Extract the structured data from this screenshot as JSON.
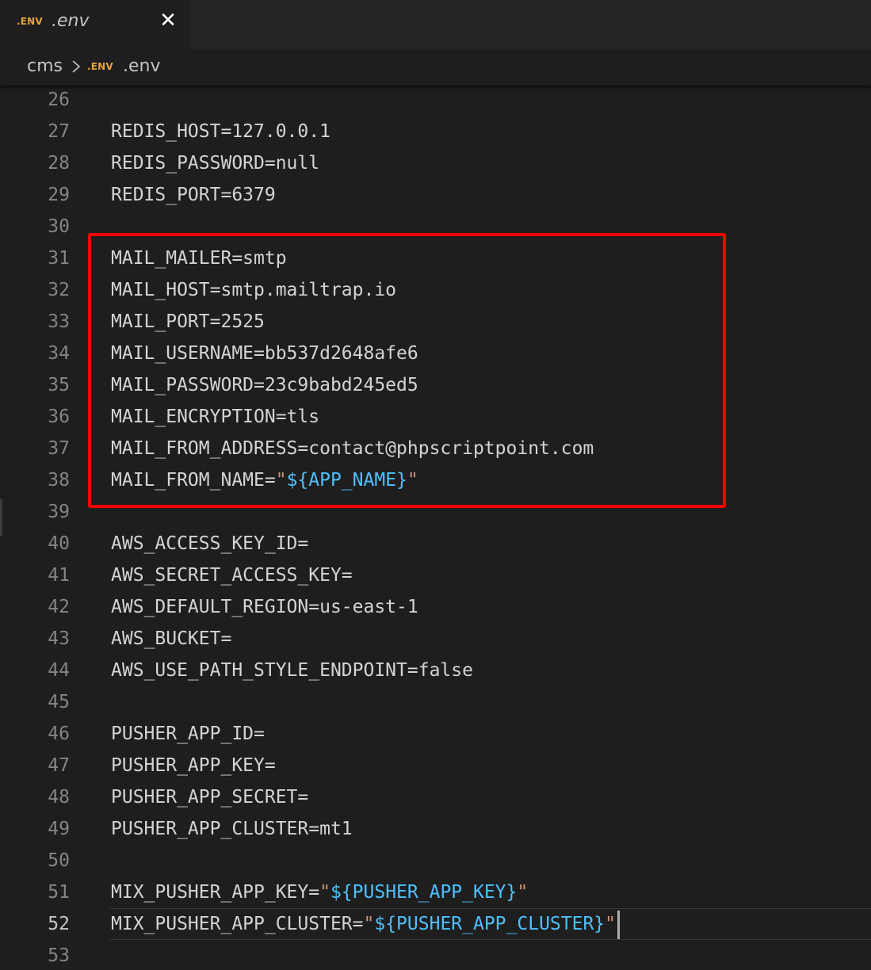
{
  "tab": {
    "badge": ".ENV",
    "label": ".env",
    "close_glyph": "✕"
  },
  "breadcrumb": {
    "folder": "cms",
    "badge": ".ENV",
    "file": ".env"
  },
  "colors": {
    "background": "#1e1e1e",
    "badge": "#e8a33d",
    "string_quote": "#ce9178",
    "template_var": "#4fc1ff",
    "highlight_box": "#ff0000"
  },
  "editor": {
    "current_line": 52,
    "lines": [
      {
        "n": "26",
        "parts": []
      },
      {
        "n": "27",
        "parts": [
          {
            "t": "REDIS_HOST=127.0.0.1",
            "c": "plain"
          }
        ]
      },
      {
        "n": "28",
        "parts": [
          {
            "t": "REDIS_PASSWORD=null",
            "c": "plain"
          }
        ]
      },
      {
        "n": "29",
        "parts": [
          {
            "t": "REDIS_PORT=6379",
            "c": "plain"
          }
        ]
      },
      {
        "n": "30",
        "parts": []
      },
      {
        "n": "31",
        "parts": [
          {
            "t": "MAIL_MAILER=smtp",
            "c": "plain"
          }
        ]
      },
      {
        "n": "32",
        "parts": [
          {
            "t": "MAIL_HOST=smtp.mailtrap.io",
            "c": "plain"
          }
        ]
      },
      {
        "n": "33",
        "parts": [
          {
            "t": "MAIL_PORT=2525",
            "c": "plain"
          }
        ]
      },
      {
        "n": "34",
        "parts": [
          {
            "t": "MAIL_USERNAME=bb537d2648afe6",
            "c": "plain"
          }
        ]
      },
      {
        "n": "35",
        "parts": [
          {
            "t": "MAIL_PASSWORD=23c9babd245ed5",
            "c": "plain"
          }
        ]
      },
      {
        "n": "36",
        "parts": [
          {
            "t": "MAIL_ENCRYPTION=tls",
            "c": "plain"
          }
        ]
      },
      {
        "n": "37",
        "parts": [
          {
            "t": "MAIL_FROM_ADDRESS=contact@phpscriptpoint.com",
            "c": "plain"
          }
        ]
      },
      {
        "n": "38",
        "parts": [
          {
            "t": "MAIL_FROM_NAME=",
            "c": "plain"
          },
          {
            "t": "\"",
            "c": "quote"
          },
          {
            "t": "${APP_NAME}",
            "c": "tmpl"
          },
          {
            "t": "\"",
            "c": "quote"
          }
        ]
      },
      {
        "n": "39",
        "parts": []
      },
      {
        "n": "40",
        "parts": [
          {
            "t": "AWS_ACCESS_KEY_ID=",
            "c": "plain"
          }
        ]
      },
      {
        "n": "41",
        "parts": [
          {
            "t": "AWS_SECRET_ACCESS_KEY=",
            "c": "plain"
          }
        ]
      },
      {
        "n": "42",
        "parts": [
          {
            "t": "AWS_DEFAULT_REGION=us-east-1",
            "c": "plain"
          }
        ]
      },
      {
        "n": "43",
        "parts": [
          {
            "t": "AWS_BUCKET=",
            "c": "plain"
          }
        ]
      },
      {
        "n": "44",
        "parts": [
          {
            "t": "AWS_USE_PATH_STYLE_ENDPOINT=false",
            "c": "plain"
          }
        ]
      },
      {
        "n": "45",
        "parts": []
      },
      {
        "n": "46",
        "parts": [
          {
            "t": "PUSHER_APP_ID=",
            "c": "plain"
          }
        ]
      },
      {
        "n": "47",
        "parts": [
          {
            "t": "PUSHER_APP_KEY=",
            "c": "plain"
          }
        ]
      },
      {
        "n": "48",
        "parts": [
          {
            "t": "PUSHER_APP_SECRET=",
            "c": "plain"
          }
        ]
      },
      {
        "n": "49",
        "parts": [
          {
            "t": "PUSHER_APP_CLUSTER=mt1",
            "c": "plain"
          }
        ]
      },
      {
        "n": "50",
        "parts": []
      },
      {
        "n": "51",
        "parts": [
          {
            "t": "MIX_PUSHER_APP_KEY=",
            "c": "plain"
          },
          {
            "t": "\"",
            "c": "quote"
          },
          {
            "t": "${PUSHER_APP_KEY}",
            "c": "tmpl"
          },
          {
            "t": "\"",
            "c": "quote"
          }
        ]
      },
      {
        "n": "52",
        "parts": [
          {
            "t": "MIX_PUSHER_APP_CLUSTER=",
            "c": "plain"
          },
          {
            "t": "\"",
            "c": "quote"
          },
          {
            "t": "${PUSHER_APP_CLUSTER}",
            "c": "tmpl"
          },
          {
            "t": "\"",
            "c": "quote"
          }
        ]
      },
      {
        "n": "53",
        "parts": []
      }
    ]
  }
}
